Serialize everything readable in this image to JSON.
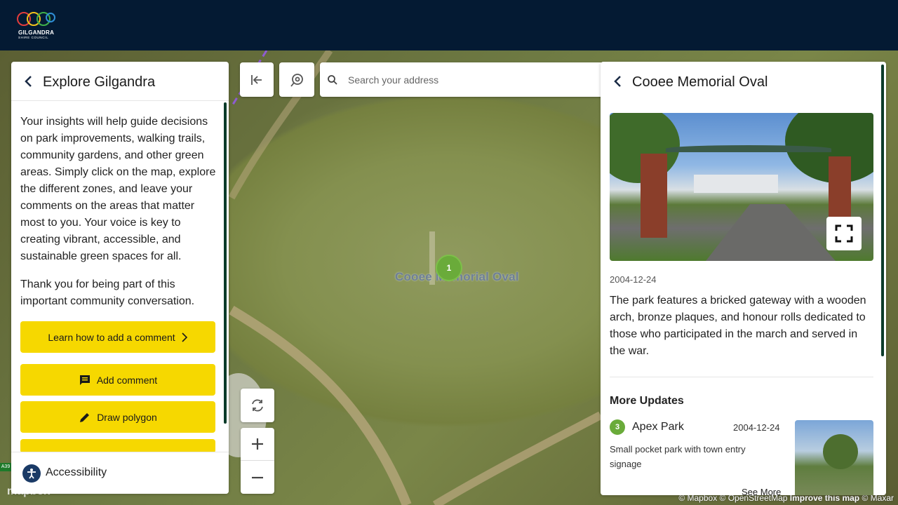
{
  "header": {
    "logo_mark": "GSC",
    "logo_name": "GILGANDRA",
    "logo_sub": "SHIRE COUNCIL",
    "background": "#041a33"
  },
  "left_panel": {
    "title": "Explore Gilgandra",
    "intro": "Your insights will help guide decisions on park improvements, walking trails, community gardens, and other green areas. Simply click on the map, explore the different zones, and leave your comments on the areas that matter most to you. Your voice is key to creating vibrant, accessible, and sustainable green spaces for all.",
    "thanks": "Thank you for being part of this important community conversation.",
    "buttons": {
      "learn": "Learn how to add a comment",
      "add_comment": "Add comment",
      "draw_polygon": "Draw polygon"
    },
    "accessibility": "Accessibility",
    "accent": "#f6d800"
  },
  "search": {
    "placeholder": "Search your address"
  },
  "map": {
    "label": "Cooee Memorial Oval",
    "cluster_count": "1",
    "road_sign": "A39",
    "logo": "mapbox",
    "credits": {
      "mapbox": "© Mapbox",
      "osm": "© OpenStreetMap",
      "improve": "Improve this map",
      "maxar": "© Maxar"
    }
  },
  "right_panel": {
    "title": "Cooee Memorial Oval",
    "date": "2004-12-24",
    "description": "The park features a bricked gateway with a wooden arch, bronze plaques, and honour rolls dedicated to those who participated in the march and served in the war.",
    "more_updates_title": "More Updates",
    "update": {
      "badge": "3",
      "name": "Apex Park",
      "date": "2004-12-24",
      "description": "Small pocket park with town entry signage",
      "see_more": "See More"
    }
  }
}
